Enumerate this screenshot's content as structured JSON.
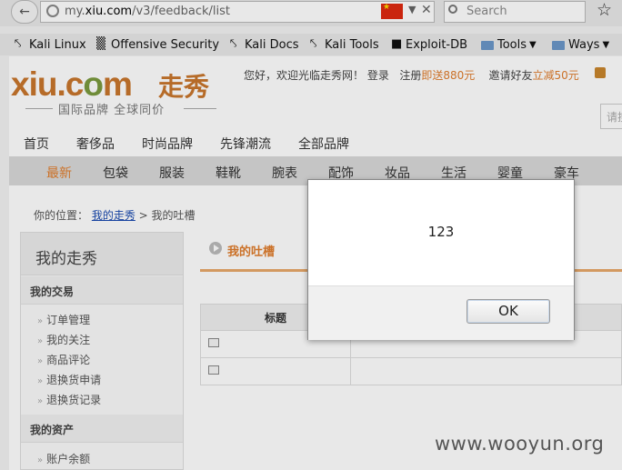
{
  "browser": {
    "url_prefix": "my.",
    "url_domain": "xiu.com",
    "url_path": "/v3/feedback/list",
    "search_placeholder": "Search",
    "bookmarks": [
      {
        "label": "Kali Linux",
        "icon": "kali-dragon-icon"
      },
      {
        "label": "Offensive Security",
        "icon": "offsec-icon"
      },
      {
        "label": "Kali Docs",
        "icon": "kali-dragon-icon"
      },
      {
        "label": "Kali Tools",
        "icon": "kali-dragon-icon"
      },
      {
        "label": "Exploit-DB",
        "icon": "exploitdb-icon"
      },
      {
        "label": "Tools",
        "icon": "folder-icon"
      },
      {
        "label": "Ways",
        "icon": "folder-icon"
      }
    ]
  },
  "site": {
    "logo_text_a": "xiu.c",
    "logo_text_b": "o",
    "logo_text_c": "m",
    "logo_cn": "走秀",
    "slogan": "国际品牌  全球同价",
    "welcome": "您好，欢迎光临走秀网！",
    "login": "登录",
    "register": "注册",
    "register_bonus": "即送880元",
    "invite": "邀请好友",
    "invite_bonus": "立减50元",
    "search_placeholder": "请搜"
  },
  "nav_primary": [
    "首页",
    "奢侈品",
    "时尚品牌",
    "先锋潮流",
    "全部品牌"
  ],
  "nav_secondary": [
    "最新",
    "包袋",
    "服装",
    "鞋靴",
    "腕表",
    "配饰",
    "妆品",
    "生活",
    "婴童",
    "豪车"
  ],
  "breadcrumb": {
    "prefix": "你的位置：",
    "link": "我的走秀",
    "sep": " > ",
    "current": "我的吐槽"
  },
  "sidebar": {
    "title": "我的走秀",
    "section1": "我的交易",
    "items1": [
      "订单管理",
      "我的关注",
      "商品评论",
      "退换货申请",
      "退换货记录"
    ],
    "section2": "我的资产",
    "items2": [
      "账户余额"
    ]
  },
  "main": {
    "title": "我的吐槽",
    "table_header": "标题"
  },
  "dialog": {
    "message": "123",
    "ok_label": "OK"
  },
  "watermark": "www.wooyun.org",
  "colors": {
    "brand_orange": "#c9762c",
    "brand_green": "#7a9a3e",
    "accent": "#e07d2c"
  }
}
